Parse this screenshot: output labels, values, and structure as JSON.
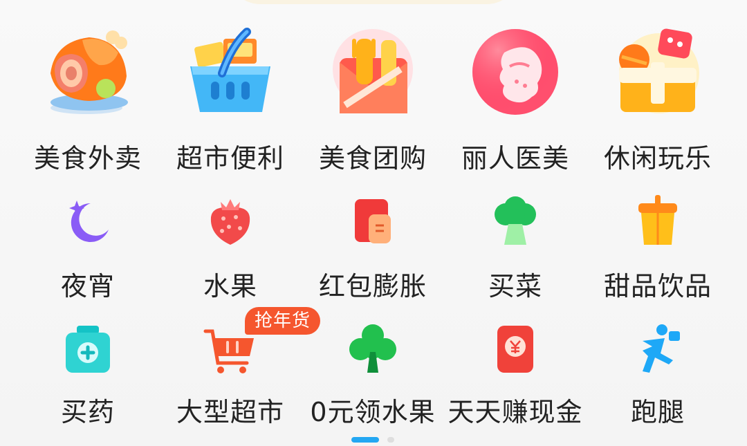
{
  "row1": [
    {
      "label": "美食外卖",
      "icon": "roast-chicken-icon"
    },
    {
      "label": "超市便利",
      "icon": "shopping-basket-icon"
    },
    {
      "label": "美食团购",
      "icon": "fork-envelope-icon"
    },
    {
      "label": "丽人医美",
      "icon": "beauty-face-icon"
    },
    {
      "label": "休闲玩乐",
      "icon": "leisure-box-icon"
    }
  ],
  "row2": [
    {
      "label": "夜宵",
      "icon": "moon-star-icon"
    },
    {
      "label": "水果",
      "icon": "strawberry-icon"
    },
    {
      "label": "红包膨胀",
      "icon": "red-packet-icon"
    },
    {
      "label": "买菜",
      "icon": "broccoli-icon"
    },
    {
      "label": "甜品饮品",
      "icon": "drink-cup-icon"
    }
  ],
  "row3": [
    {
      "label": "买药",
      "icon": "medicine-box-icon"
    },
    {
      "label": "大型超市",
      "icon": "shopping-cart-icon"
    },
    {
      "label": "0元领水果",
      "icon": "tree-icon"
    },
    {
      "label": "天天赚现金",
      "icon": "cash-envelope-icon"
    },
    {
      "label": "跑腿",
      "icon": "running-courier-icon"
    }
  ],
  "badge": {
    "text": "抢年货"
  },
  "pager": {
    "pages": 2,
    "current": 1
  },
  "colors": {
    "accent": "#23a7f2",
    "badge": "#f5562e",
    "label": "#222222"
  }
}
